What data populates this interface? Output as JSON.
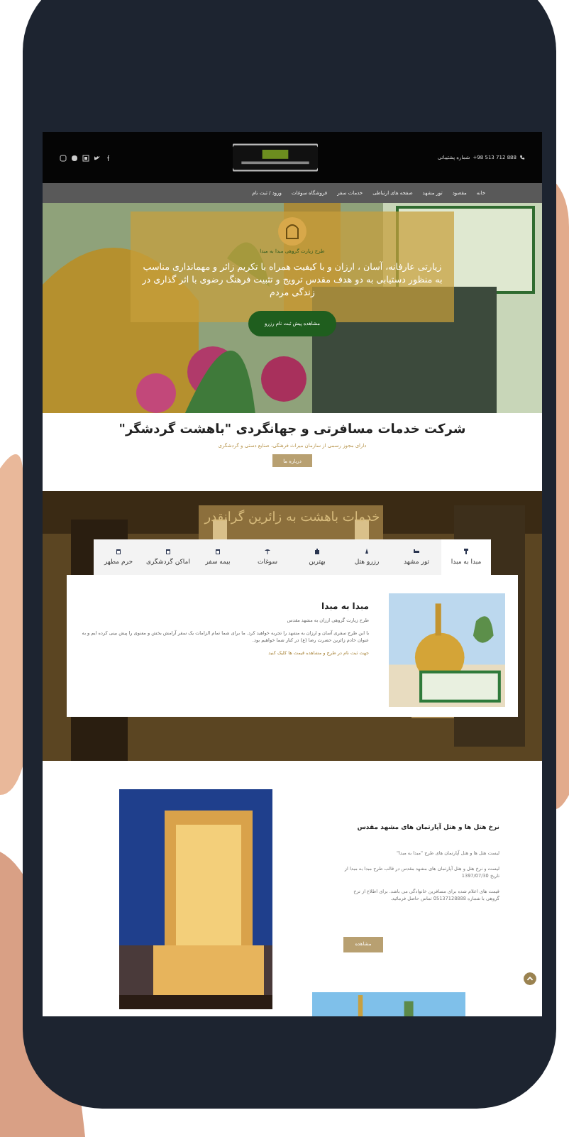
{
  "top_bar": {
    "phone_label": "شماره پشتیبانی",
    "phone": "+98 513 712 888"
  },
  "nav": {
    "items": [
      {
        "label": "خانه"
      },
      {
        "label": "مقصود"
      },
      {
        "label": "تور مشهد"
      },
      {
        "label": "صفحه های ارتباطی"
      },
      {
        "label": "خدمات سفر"
      },
      {
        "label": "فروشگاه سوغات"
      },
      {
        "label": "ورود / ثبت نام"
      }
    ]
  },
  "hero": {
    "caption": "طرح زیارت گروهی مبدا به مبدا",
    "text": "زیارتی عارفانه، آسان ، ارزان و با کیفیت همراه با تکریم زائر و مهمانداری مناسب به منظور دستیابی به دو هدف مقدس ترویج و تثبیت فرهنگ رضوی با اثر گذاری در زندگی مردم",
    "button": "مشاهده پیش ثبت نام رزرو"
  },
  "intro": {
    "title": "شرکت خدمات مسافرتی و جهانگردی \"باهشت گردشگر\"",
    "subtitle": "دارای مجوز رسمی از سازمان میراث فرهنگی، صنایع دستی و گردشگری",
    "button": "درباره ما"
  },
  "services": {
    "title": "خدمات باهشت به زائرین گرانقدر",
    "tabs": [
      {
        "label": "مبدا به مبدا",
        "selected": true
      },
      {
        "label": "تور مشهد",
        "selected": false
      },
      {
        "label": "رزرو هتل",
        "selected": false
      },
      {
        "label": "بهترین",
        "selected": false
      },
      {
        "label": "سوغات",
        "selected": false
      },
      {
        "label": "بیمه سفر",
        "selected": false
      },
      {
        "label": "اماکن گردشگری",
        "selected": false
      },
      {
        "label": "حرم مطهر",
        "selected": false
      }
    ],
    "panel": {
      "title": "مبدا به مبدا",
      "subtitle": "طرح زیارت گروهی ارزان به مشهد مقدس",
      "text": "با این طرح سفری آسان و ارزان به مشهد را تجربه خواهید کرد. ما برای شما تمام الزامات یک سفر آرامش بخش و معنوی را پیش بینی کرده ایم و به عنوان خادم زائرین حضرت رضا (ع) در کنار شما خواهیم بود.",
      "link": "جهت ثبت نام در طرح و مشاهده قیمت ها کلیک کنید"
    }
  },
  "hotels": {
    "title": "نرخ هتل ها و هتل آپارتمان های مشهد مقدس",
    "paragraphs": [
      "لیست هتل ها و هتل آپارتمان های طرح \"مبدا به مبدا\"",
      "لیست و نرخ هتل و هتل آپارتمان های مشهد مقدس در قالب طرح مبدا به مبدا از تاریخ 1397/07/30",
      "قیمت های اعلام شده برای مسافرین خانوادگی می باشد. برای اطلاع از نرخ گروهی با شماره 05137128888 تماس حاصل فرمائید."
    ],
    "button": "مشاهده"
  }
}
